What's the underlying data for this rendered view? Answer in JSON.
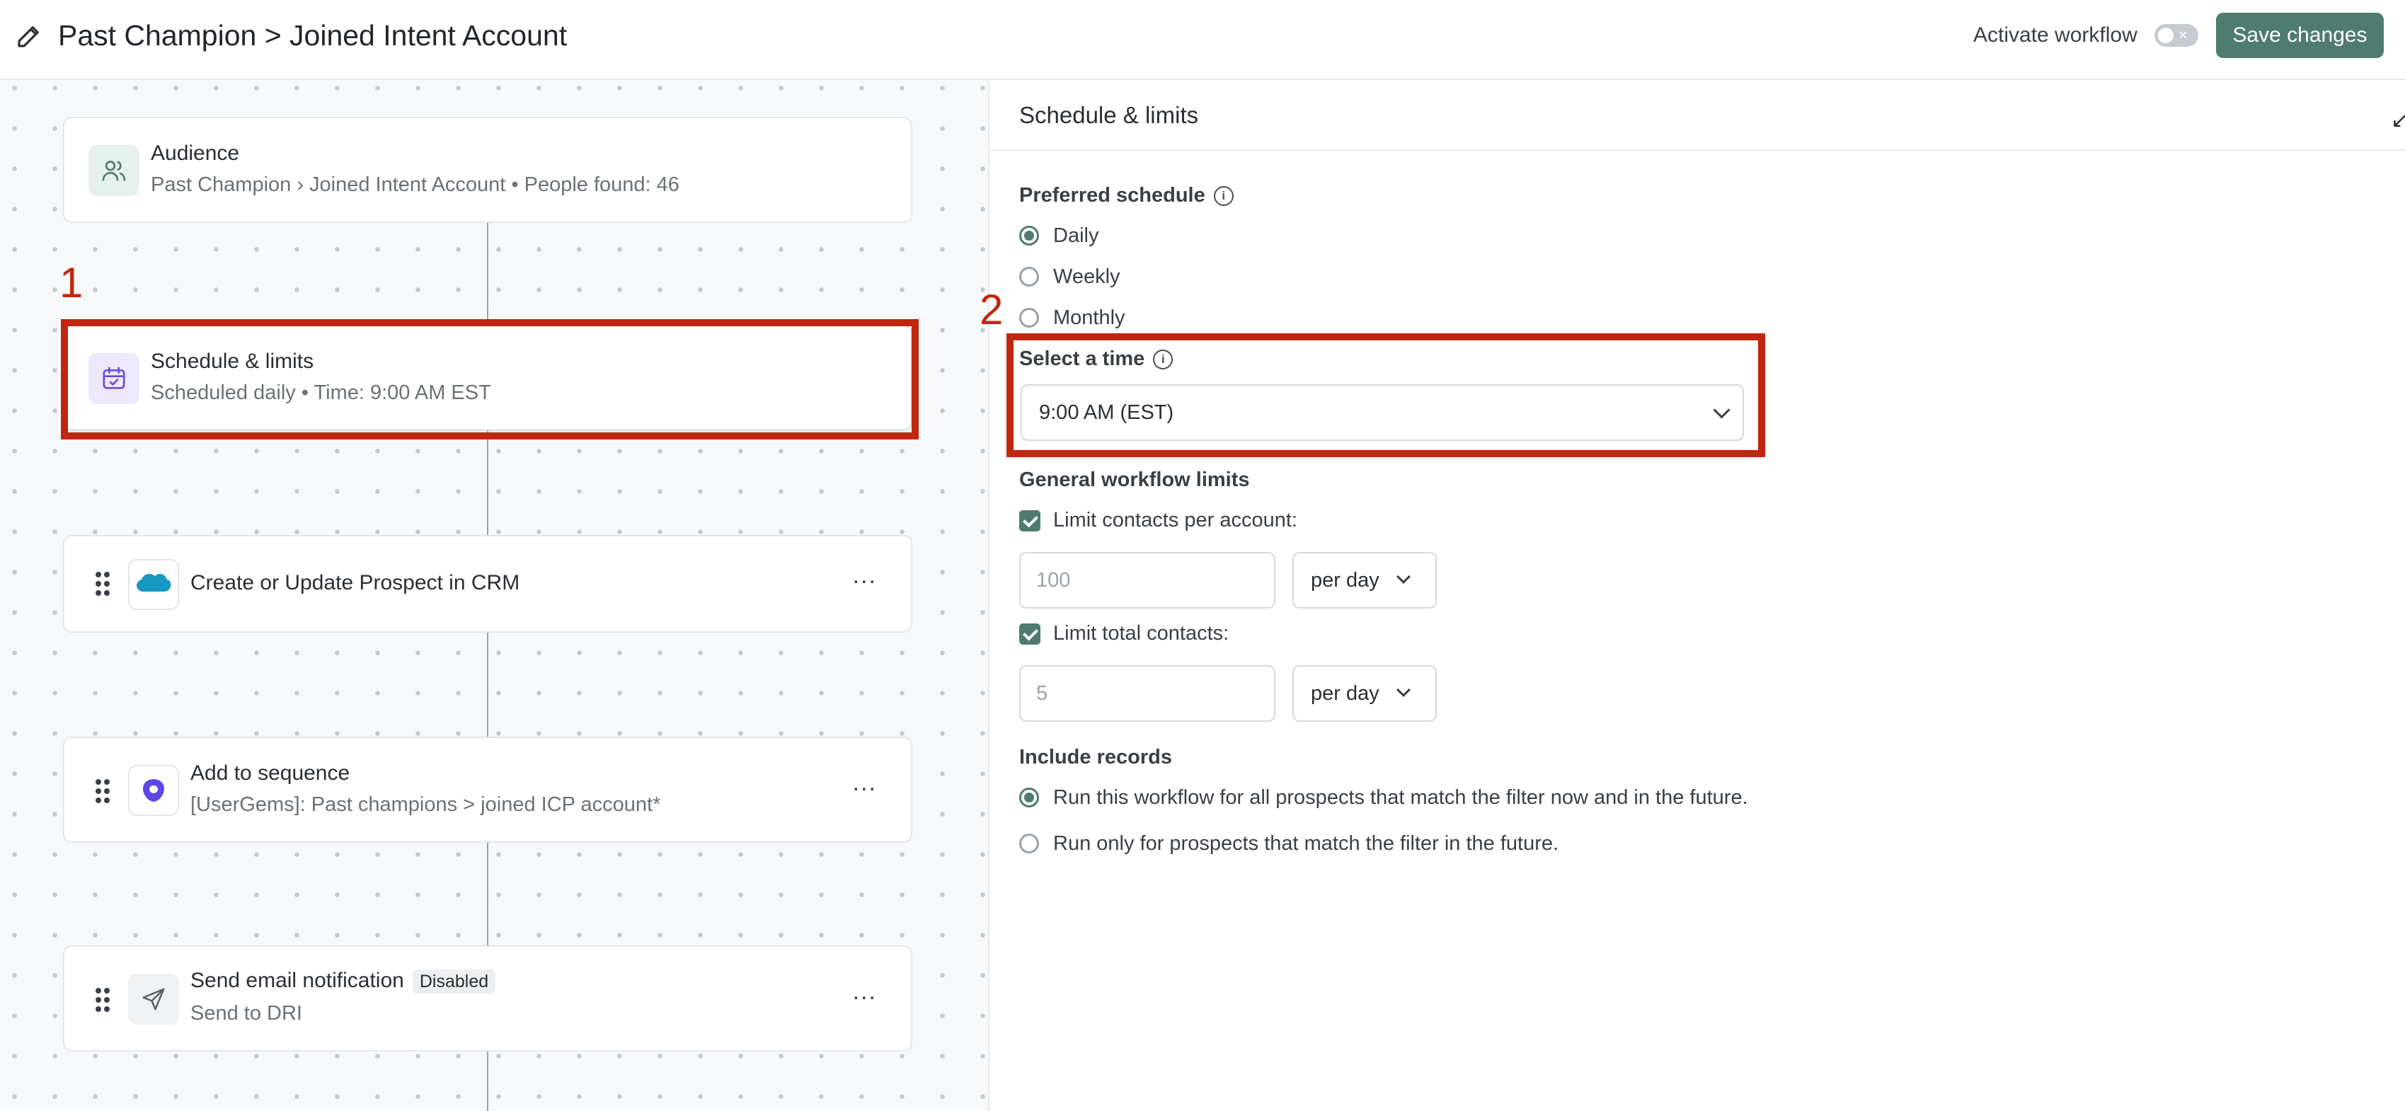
{
  "header": {
    "title": "Past Champion > Joined Intent Account",
    "activate_label": "Activate workflow",
    "toggle_off_symbol": "×",
    "save_label": "Save changes",
    "accent_color": "#4f7b70"
  },
  "canvas": {
    "cards": [
      {
        "title": "Audience",
        "subtitle": "Past Champion › Joined Intent Account • People found: 46",
        "icon": "users-icon"
      },
      {
        "title": "Schedule & limits",
        "subtitle": "Scheduled daily • Time: 9:00 AM EST",
        "icon": "calendar-check-icon"
      },
      {
        "title": "Create or Update Prospect in CRM",
        "icon": "salesforce-icon",
        "icon_text": "salesforce",
        "more": "..."
      },
      {
        "title": "Add to sequence",
        "subtitle": "[UserGems]: Past champions > joined ICP account*",
        "icon": "outreach-icon",
        "more": "..."
      },
      {
        "title": "Send email notification",
        "badge": "Disabled",
        "subtitle": "Send to DRI",
        "icon": "send-icon",
        "more": "..."
      }
    ]
  },
  "annotations": {
    "first": "1",
    "second": "2",
    "color": "#c0270e"
  },
  "panel": {
    "title": "Schedule & limits",
    "collapse_icon": "↙",
    "preferred_schedule": {
      "label": "Preferred schedule",
      "info": "i",
      "options": [
        "Daily",
        "Weekly",
        "Monthly"
      ],
      "selected": "Daily"
    },
    "select_time": {
      "label": "Select a time",
      "info": "i",
      "value": "9:00 AM (EST)"
    },
    "limits": {
      "label": "General workflow limits",
      "per_account": {
        "label": "Limit contacts per account:",
        "checked": true,
        "placeholder": "100",
        "period": "per day"
      },
      "total": {
        "label": "Limit total contacts:",
        "checked": true,
        "placeholder": "5",
        "period": "per day"
      }
    },
    "include_records": {
      "label": "Include records",
      "options": [
        "Run this workflow for all prospects that match the filter now and in the future.",
        "Run only for prospects that match the filter in the future."
      ],
      "selected_index": 0
    }
  }
}
